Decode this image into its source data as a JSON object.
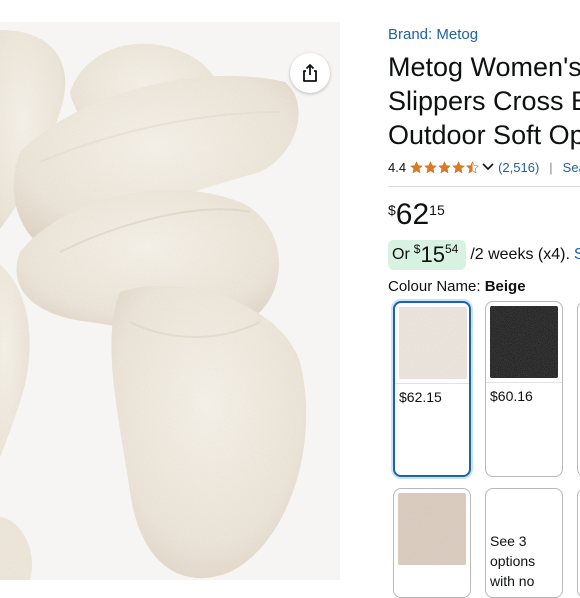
{
  "share": {
    "icon": "share-icon"
  },
  "product": {
    "brand_label": "Brand: Metog",
    "title_lines": [
      "Metog Women's",
      "Slippers Cross B",
      "Outdoor Soft Op"
    ],
    "rating": "4.4",
    "stars_value": 4.5,
    "review_count": "(2,516)",
    "search_link": "Sea",
    "price": {
      "currency": "$",
      "whole": "62",
      "fraction": "15"
    },
    "installment": {
      "prefix": "Or",
      "currency": "$",
      "whole": "15",
      "fraction": "54",
      "suffix": "/2 weeks (x4).",
      "link": "S"
    },
    "colour_label": "Colour Name:",
    "colour_value": "Beige"
  },
  "swatches": [
    {
      "name": "Beige",
      "price": "$62.15",
      "selected": true
    },
    {
      "name": "Black",
      "price": "$60.16",
      "selected": false
    },
    {
      "name": "Tan",
      "price": "",
      "selected": false
    },
    {
      "name": "More",
      "text": "See 3 options with no",
      "selected": false
    }
  ],
  "colors": {
    "link": "#2162a1",
    "star": "#de7921",
    "install_bg": "#d7f2e1",
    "selected_border": "#2162a1"
  }
}
